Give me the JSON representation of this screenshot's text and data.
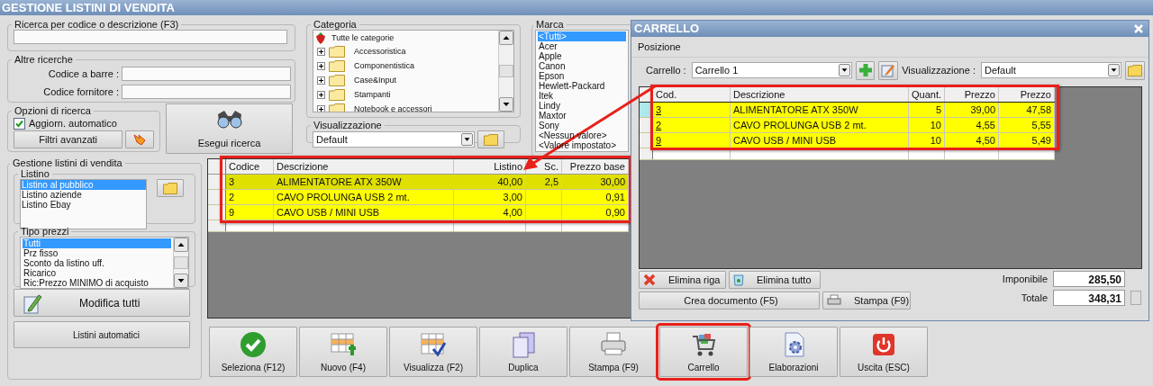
{
  "window": {
    "title": "GESTIONE LISTINI DI VENDITA"
  },
  "search": {
    "title": "Ricerca per codice o descrizione (F3)"
  },
  "other_searches": {
    "title": "Altre ricerche",
    "fields": [
      {
        "label": "Codice a barre :"
      },
      {
        "label": "Codice fornitore :"
      }
    ]
  },
  "search_options": {
    "title": "Opzioni di ricerca",
    "auto_update": {
      "label": "Aggiorn. automatico",
      "checked": true
    },
    "filters_button": "Filtri avanzati"
  },
  "run_search": {
    "label": "Esegui ricerca"
  },
  "price_lists": {
    "title": "Gestione listini di vendita",
    "list_title": "Listino",
    "lists": [
      {
        "label": "Listino al pubblico",
        "selected": true
      },
      {
        "label": "Listino aziende",
        "selected": false
      },
      {
        "label": "Listino Ebay",
        "selected": false
      }
    ],
    "price_type_title": "Tipo prezzi",
    "price_types": [
      {
        "label": "Tutti",
        "selected": true
      },
      {
        "label": "Prz fisso",
        "selected": false
      },
      {
        "label": "Sconto da listino uff.",
        "selected": false
      },
      {
        "label": "Ricarico",
        "selected": false
      },
      {
        "label": "Ric:Prezzo MINIMO di acquisto",
        "selected": false
      }
    ],
    "edit_all": "Modifica tutti",
    "auto_lists": "Listini automatici"
  },
  "category": {
    "title": "Categoria",
    "tree": [
      {
        "label": "Tutte le categorie",
        "children": [
          {
            "label": "Accessoristica"
          },
          {
            "label": "Componentistica"
          },
          {
            "label": "Case&Input"
          },
          {
            "label": "Stampanti"
          },
          {
            "label": "Notebook e accessori"
          }
        ]
      }
    ]
  },
  "view": {
    "title": "Visualizzazione",
    "value": "Default"
  },
  "brand": {
    "title": "Marca",
    "items": [
      {
        "label": "<Tutti>",
        "selected": true
      },
      {
        "label": "Acer",
        "selected": false
      },
      {
        "label": "Apple",
        "selected": false
      },
      {
        "label": "Canon",
        "selected": false
      },
      {
        "label": "Epson",
        "selected": false
      },
      {
        "label": "Hewlett-Packard",
        "selected": false
      },
      {
        "label": "Itek",
        "selected": false
      },
      {
        "label": "Lindy",
        "selected": false
      },
      {
        "label": "Maxtor",
        "selected": false
      },
      {
        "label": "Sony",
        "selected": false
      },
      {
        "label": "<Nessun valore>",
        "selected": false
      },
      {
        "label": "<Valore impostato>",
        "selected": false
      }
    ]
  },
  "table": {
    "highlighted": true,
    "columns": [
      "Codice",
      "Descrizione",
      "Listino",
      "Sc.",
      "Prezzo base"
    ],
    "rows": [
      {
        "selected": true,
        "cells": [
          "3",
          "ALIMENTATORE ATX 350W",
          "40,00",
          "2,5",
          "30,00"
        ]
      },
      {
        "selected": false,
        "cells": [
          "2",
          "CAVO PROLUNGA USB 2 mt.",
          "3,00",
          "",
          "0,91"
        ]
      },
      {
        "selected": false,
        "cells": [
          "9",
          "CAVO USB / MINI USB",
          "4,00",
          "",
          "0,90"
        ]
      }
    ]
  },
  "toolbar": [
    {
      "label": "Seleziona (F12)",
      "highlighted": false
    },
    {
      "label": "Nuovo (F4)",
      "highlighted": false
    },
    {
      "label": "Visualizza (F2)",
      "highlighted": false
    },
    {
      "label": "Duplica",
      "highlighted": false
    },
    {
      "label": "Stampa (F9)",
      "highlighted": false
    },
    {
      "label": "Carrello",
      "highlighted": true
    },
    {
      "label": "Elaborazioni",
      "highlighted": false
    },
    {
      "label": "Uscita (ESC)",
      "highlighted": false
    }
  ],
  "cart": {
    "title": "CARRELLO",
    "menu": [
      "Posizione"
    ],
    "cart_label": "Carrello :",
    "cart_value": "Carrello 1",
    "view_label": "Visualizzazione :",
    "view_value": "Default",
    "table": {
      "highlighted": true,
      "columns": [
        "Cod.",
        "Descrizione",
        "Quant.",
        "Prezzo",
        "Prezzo"
      ],
      "rows": [
        {
          "current": true,
          "cells": [
            "3",
            "ALIMENTATORE ATX 350W",
            "5",
            "39,00",
            "47,58"
          ]
        },
        {
          "current": false,
          "cells": [
            "2",
            "CAVO PROLUNGA USB 2 mt.",
            "10",
            "4,55",
            "5,55"
          ]
        },
        {
          "current": false,
          "cells": [
            "9",
            "CAVO USB / MINI USB",
            "10",
            "4,50",
            "5,49"
          ]
        }
      ]
    },
    "delete_row": "Elimina riga",
    "delete_all": "Elimina tutto",
    "create_document": "Crea documento (F5)",
    "print": "Stampa (F9)",
    "taxable_label": "Imponibile",
    "taxable": "285,50",
    "total_label": "Totale",
    "total": "348,31"
  }
}
